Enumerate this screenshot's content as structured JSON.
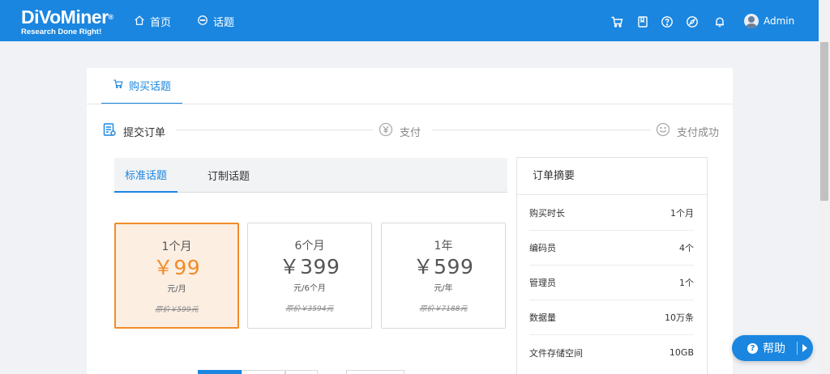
{
  "brand": {
    "name": "DiVoMiner",
    "reg_mark": "®",
    "tagline": "Research Done Right!"
  },
  "nav": {
    "home": "首页",
    "topics": "话题"
  },
  "header_icons": [
    "cart-icon",
    "book-icon",
    "help-circle-icon",
    "compass-icon",
    "bell-icon"
  ],
  "user": {
    "name": "Admin"
  },
  "page_tab": "购买话题",
  "steps": [
    "提交订单",
    "支付",
    "支付成功"
  ],
  "topic_tabs": [
    "标准话题",
    "订制话题"
  ],
  "plans": [
    {
      "duration": "1个月",
      "price": "￥99",
      "unit": "元/月",
      "original": "原价￥599元"
    },
    {
      "duration": "6个月",
      "price": "￥399",
      "unit": "元/6个月",
      "original": "原价￥3594元"
    },
    {
      "duration": "1年",
      "price": "￥599",
      "unit": "元/年",
      "original": "原价￥7188元"
    }
  ],
  "summary": {
    "title": "订单摘要",
    "rows": [
      {
        "label": "购买时长",
        "value": "1个月"
      },
      {
        "label": "编码员",
        "value": "4个"
      },
      {
        "label": "管理员",
        "value": "1个"
      },
      {
        "label": "数据量",
        "value": "10万条"
      },
      {
        "label": "文件存储空间",
        "value": "10GB"
      }
    ]
  },
  "help_button": "帮助",
  "colors": {
    "primary": "#1a86e0",
    "accent": "#f08c28",
    "selected_bg": "#fdeee2"
  }
}
